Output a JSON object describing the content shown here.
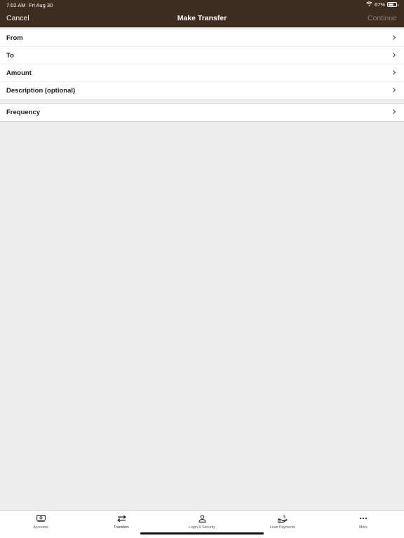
{
  "status_bar": {
    "time": "7:02 AM",
    "date": "Fri Aug 30",
    "battery": "67%",
    "battery_level": 0.67
  },
  "nav": {
    "cancel_label": "Cancel",
    "title": "Make Transfer",
    "continue_label": "Continue"
  },
  "form": {
    "rows": [
      {
        "label": "From"
      },
      {
        "label": "To"
      },
      {
        "label": "Amount"
      },
      {
        "label": "Description (optional)"
      }
    ],
    "frequency": {
      "label": "Frequency"
    }
  },
  "tabbar": {
    "items": [
      {
        "label": "Accounts",
        "icon": "accounts-icon"
      },
      {
        "label": "Transfers",
        "icon": "transfers-icon",
        "active": true
      },
      {
        "label": "Login & Security",
        "icon": "person-icon"
      },
      {
        "label": "Loan Payments",
        "icon": "loan-payment-icon"
      },
      {
        "label": "More",
        "icon": "more-icon"
      }
    ]
  },
  "colors": {
    "header_bg": "#3d2c20",
    "background": "#ededed",
    "continue_disabled": "#8c7f74"
  }
}
